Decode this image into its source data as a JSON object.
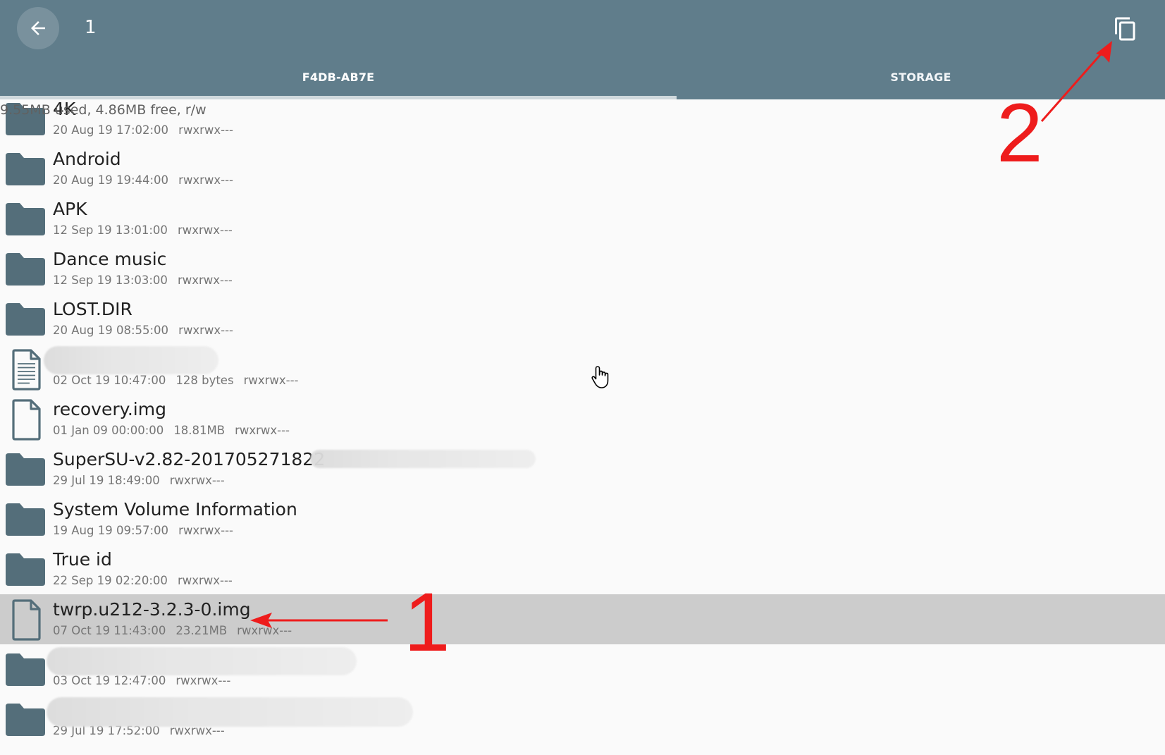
{
  "appbar": {
    "title": "1",
    "tabs": [
      {
        "label": "F4DB-AB7E",
        "active": true
      },
      {
        "label": "STORAGE",
        "active": false
      }
    ]
  },
  "storage_info": "9.55MB used, 4.86MB free, r/w",
  "files": [
    {
      "name": "4K",
      "type": "folder",
      "date": "20 Aug 19 17:02:00",
      "size": "",
      "perms": "rwxrwx---"
    },
    {
      "name": "Android",
      "type": "folder",
      "date": "20 Aug 19 19:44:00",
      "size": "",
      "perms": "rwxrwx---"
    },
    {
      "name": "APK",
      "type": "folder",
      "date": "12 Sep 19 13:01:00",
      "size": "",
      "perms": "rwxrwx---"
    },
    {
      "name": "Dance music",
      "type": "folder",
      "date": "12 Sep 19 13:03:00",
      "size": "",
      "perms": "rwxrwx---"
    },
    {
      "name": "LOST.DIR",
      "type": "folder",
      "date": "20 Aug 19 08:55:00",
      "size": "",
      "perms": "rwxrwx---"
    },
    {
      "name": "",
      "type": "text",
      "date": "02 Oct 19 10:47:00",
      "size": "128 bytes",
      "perms": "rwxrwx---"
    },
    {
      "name": "recovery.img",
      "type": "file",
      "date": "01 Jan 09 00:00:00",
      "size": "18.81MB",
      "perms": "rwxrwx---"
    },
    {
      "name": "SuperSU-v2.82-201705271822",
      "type": "folder",
      "date": "29 Jul 19 18:49:00",
      "size": "",
      "perms": "rwxrwx---"
    },
    {
      "name": "System Volume Information",
      "type": "folder",
      "date": "19 Aug 19 09:57:00",
      "size": "",
      "perms": "rwxrwx---"
    },
    {
      "name": "True id",
      "type": "folder",
      "date": "22 Sep 19 02:20:00",
      "size": "",
      "perms": "rwxrwx---"
    },
    {
      "name": "twrp.u212-3.2.3-0.img",
      "type": "file",
      "date": "07 Oct 19 11:43:00",
      "size": "23.21MB",
      "perms": "rwxrwx---",
      "selected": true
    },
    {
      "name": "",
      "type": "folder",
      "date": "03 Oct 19 12:47:00",
      "size": "",
      "perms": "rwxrwx---"
    },
    {
      "name": "",
      "type": "folder",
      "date": "29 Jul 19 17:52:00",
      "size": "",
      "perms": "rwxrwx---"
    }
  ],
  "annotations": {
    "step1": "1",
    "step2": "2"
  },
  "colors": {
    "appbar": "#607d8b",
    "icon": "#546e7a",
    "selected_row": "#cccccc",
    "annotation": "#ee1c1c"
  }
}
